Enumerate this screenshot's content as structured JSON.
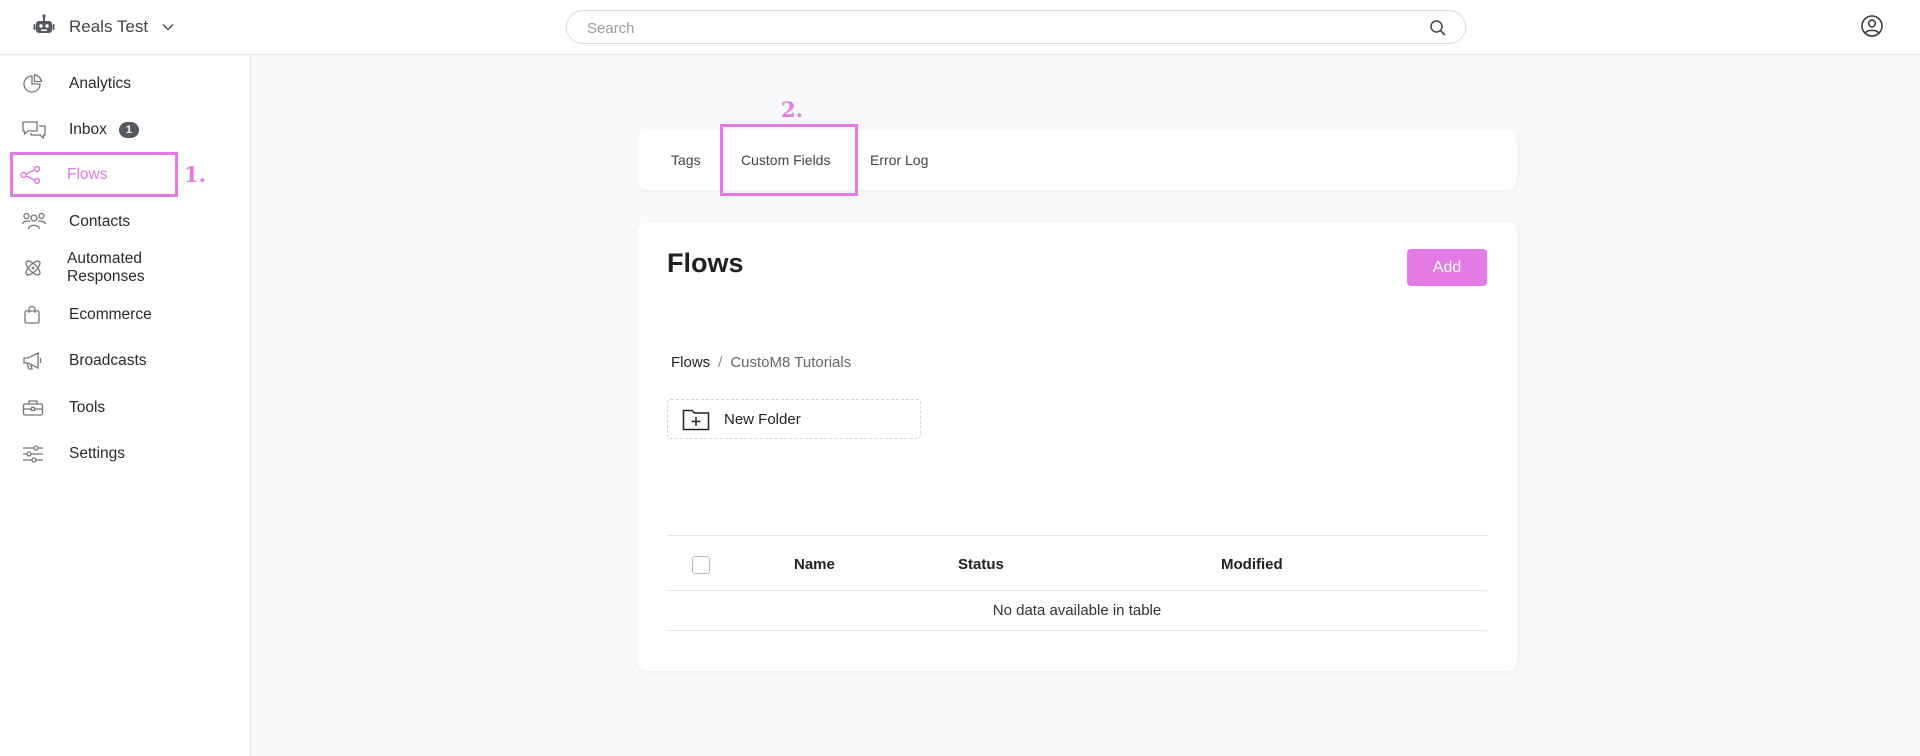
{
  "header": {
    "workspace_name": "Reals Test",
    "search_placeholder": "Search",
    "search_value": ""
  },
  "sidebar": {
    "items": [
      {
        "label": "Analytics",
        "icon": "analytics-pie-icon"
      },
      {
        "label": "Inbox",
        "icon": "chat-bubbles-icon",
        "badge": "1"
      },
      {
        "label": "Flows",
        "icon": "share-nodes-icon",
        "active": true
      },
      {
        "label": "Contacts",
        "icon": "users-icon"
      },
      {
        "label": "Automated Responses",
        "icon": "atom-icon"
      },
      {
        "label": "Ecommerce",
        "icon": "shopping-bag-icon"
      },
      {
        "label": "Broadcasts",
        "icon": "megaphone-icon"
      },
      {
        "label": "Tools",
        "icon": "toolbox-icon"
      },
      {
        "label": "Settings",
        "icon": "sliders-icon"
      }
    ]
  },
  "annotations": {
    "step1": "1.",
    "step2": "2."
  },
  "tabs": [
    {
      "label": "Tags"
    },
    {
      "label": "Custom Fields"
    },
    {
      "label": "Error Log"
    }
  ],
  "main": {
    "title": "Flows",
    "add_label": "Add",
    "breadcrumb": {
      "root": "Flows",
      "separator": "/",
      "current": "CustoM8 Tutorials"
    },
    "new_folder_label": "New Folder",
    "table": {
      "columns": [
        "Name",
        "Status",
        "Modified"
      ],
      "empty_message": "No data available in table"
    }
  },
  "colors": {
    "accent": "#e47ae4",
    "badge": "#555a61"
  }
}
